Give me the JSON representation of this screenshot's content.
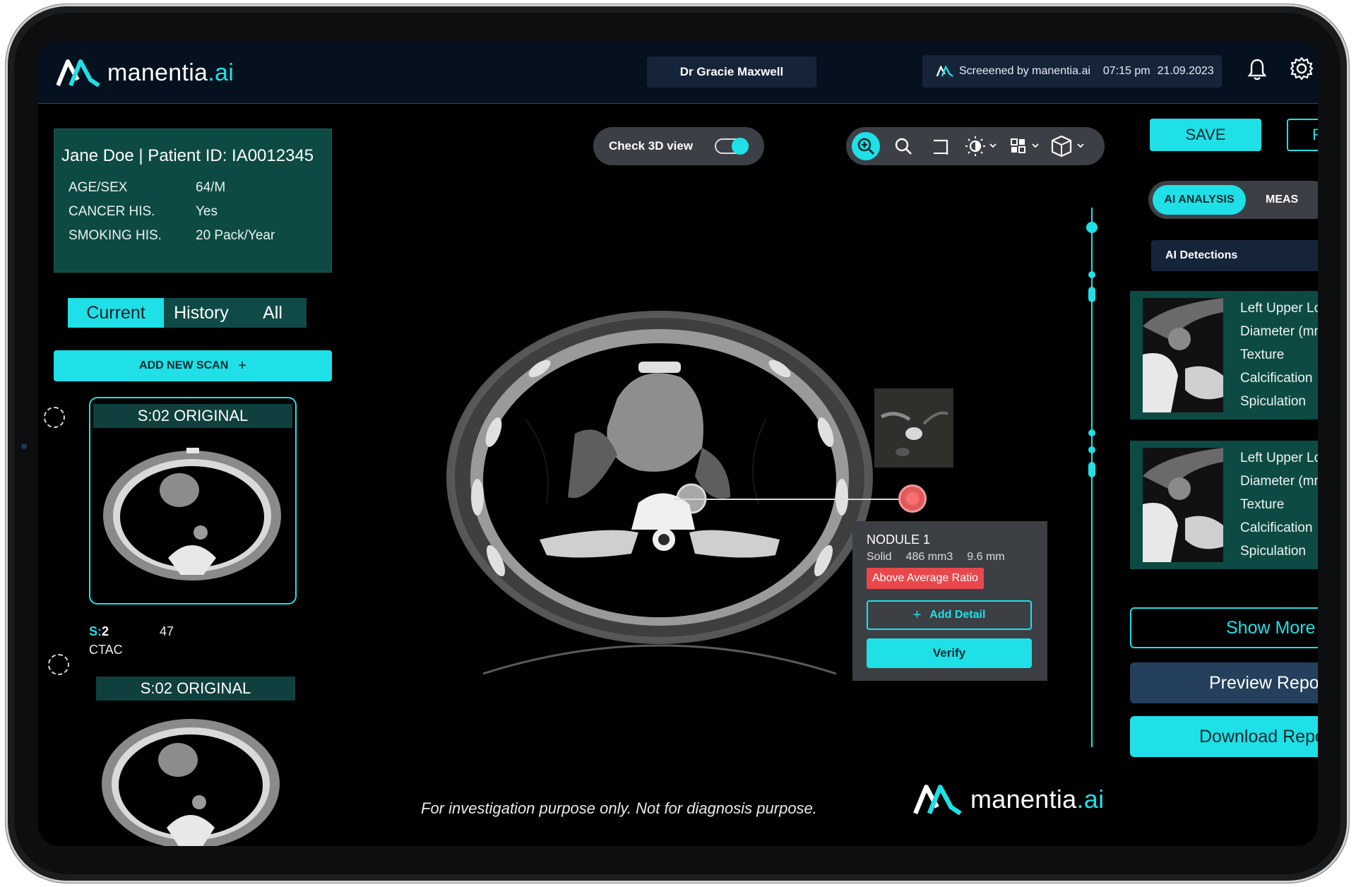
{
  "brand": {
    "name": "manentia",
    "suffix": ".ai"
  },
  "header": {
    "doctor": "Dr Gracie Maxwell",
    "screened_by": "Screeened by manentia.ai",
    "time": "07:15 pm",
    "date": "21.09.2023"
  },
  "patient": {
    "title": "Jane Doe | Patient ID: IA0012345",
    "fields": [
      {
        "label": "AGE/SEX",
        "value": "64/M"
      },
      {
        "label": "CANCER HIS.",
        "value": "Yes"
      },
      {
        "label": "SMOKING HIS.",
        "value": "20 Pack/Year"
      }
    ]
  },
  "history_tabs": [
    "Current",
    "History",
    "All"
  ],
  "add_scan": "ADD NEW SCAN",
  "add_symbol": "+",
  "scans": [
    {
      "title": "S:02 ORIGINAL",
      "series_prefix": "S:",
      "series_num": "2",
      "count": "47",
      "type": "CTAC"
    },
    {
      "title": "S:02 ORIGINAL"
    }
  ],
  "viewer": {
    "check3d_label": "Check 3D view",
    "disclaimer": "For investigation purpose only. Not for diagnosis purpose."
  },
  "nodule": {
    "title": "NODULE 1",
    "kind": "Solid",
    "volume": "486 mm3",
    "size": "9.6 mm",
    "badge": "Above Average Ratio",
    "add_detail": "Add Detail",
    "verify": "Verify"
  },
  "right": {
    "save": "SAVE",
    "second_button": "R",
    "tabs": [
      "AI ANALYSIS",
      "MEAS"
    ],
    "detections_label": "AI Detections",
    "detections": [
      {
        "lines": [
          "Left Upper Lo",
          "Diameter (mm",
          "Texture",
          "Calcification",
          "Spiculation"
        ]
      },
      {
        "lines": [
          "Left Upper Lo",
          "Diameter (mm",
          "Texture",
          "Calcification",
          "Spiculation"
        ]
      }
    ],
    "show_more": "Show More",
    "preview": "Preview Repor",
    "download": "Download Repo"
  },
  "colors": {
    "accent": "#1fe0e6",
    "panel": "#0d4a44",
    "alert": "#e8484c",
    "navy": "#16243a"
  },
  "icons": [
    "bell-icon",
    "gear-icon",
    "zoom-in-icon",
    "search-icon",
    "crop-icon",
    "brightness-icon",
    "grid-icon",
    "cube-icon"
  ]
}
